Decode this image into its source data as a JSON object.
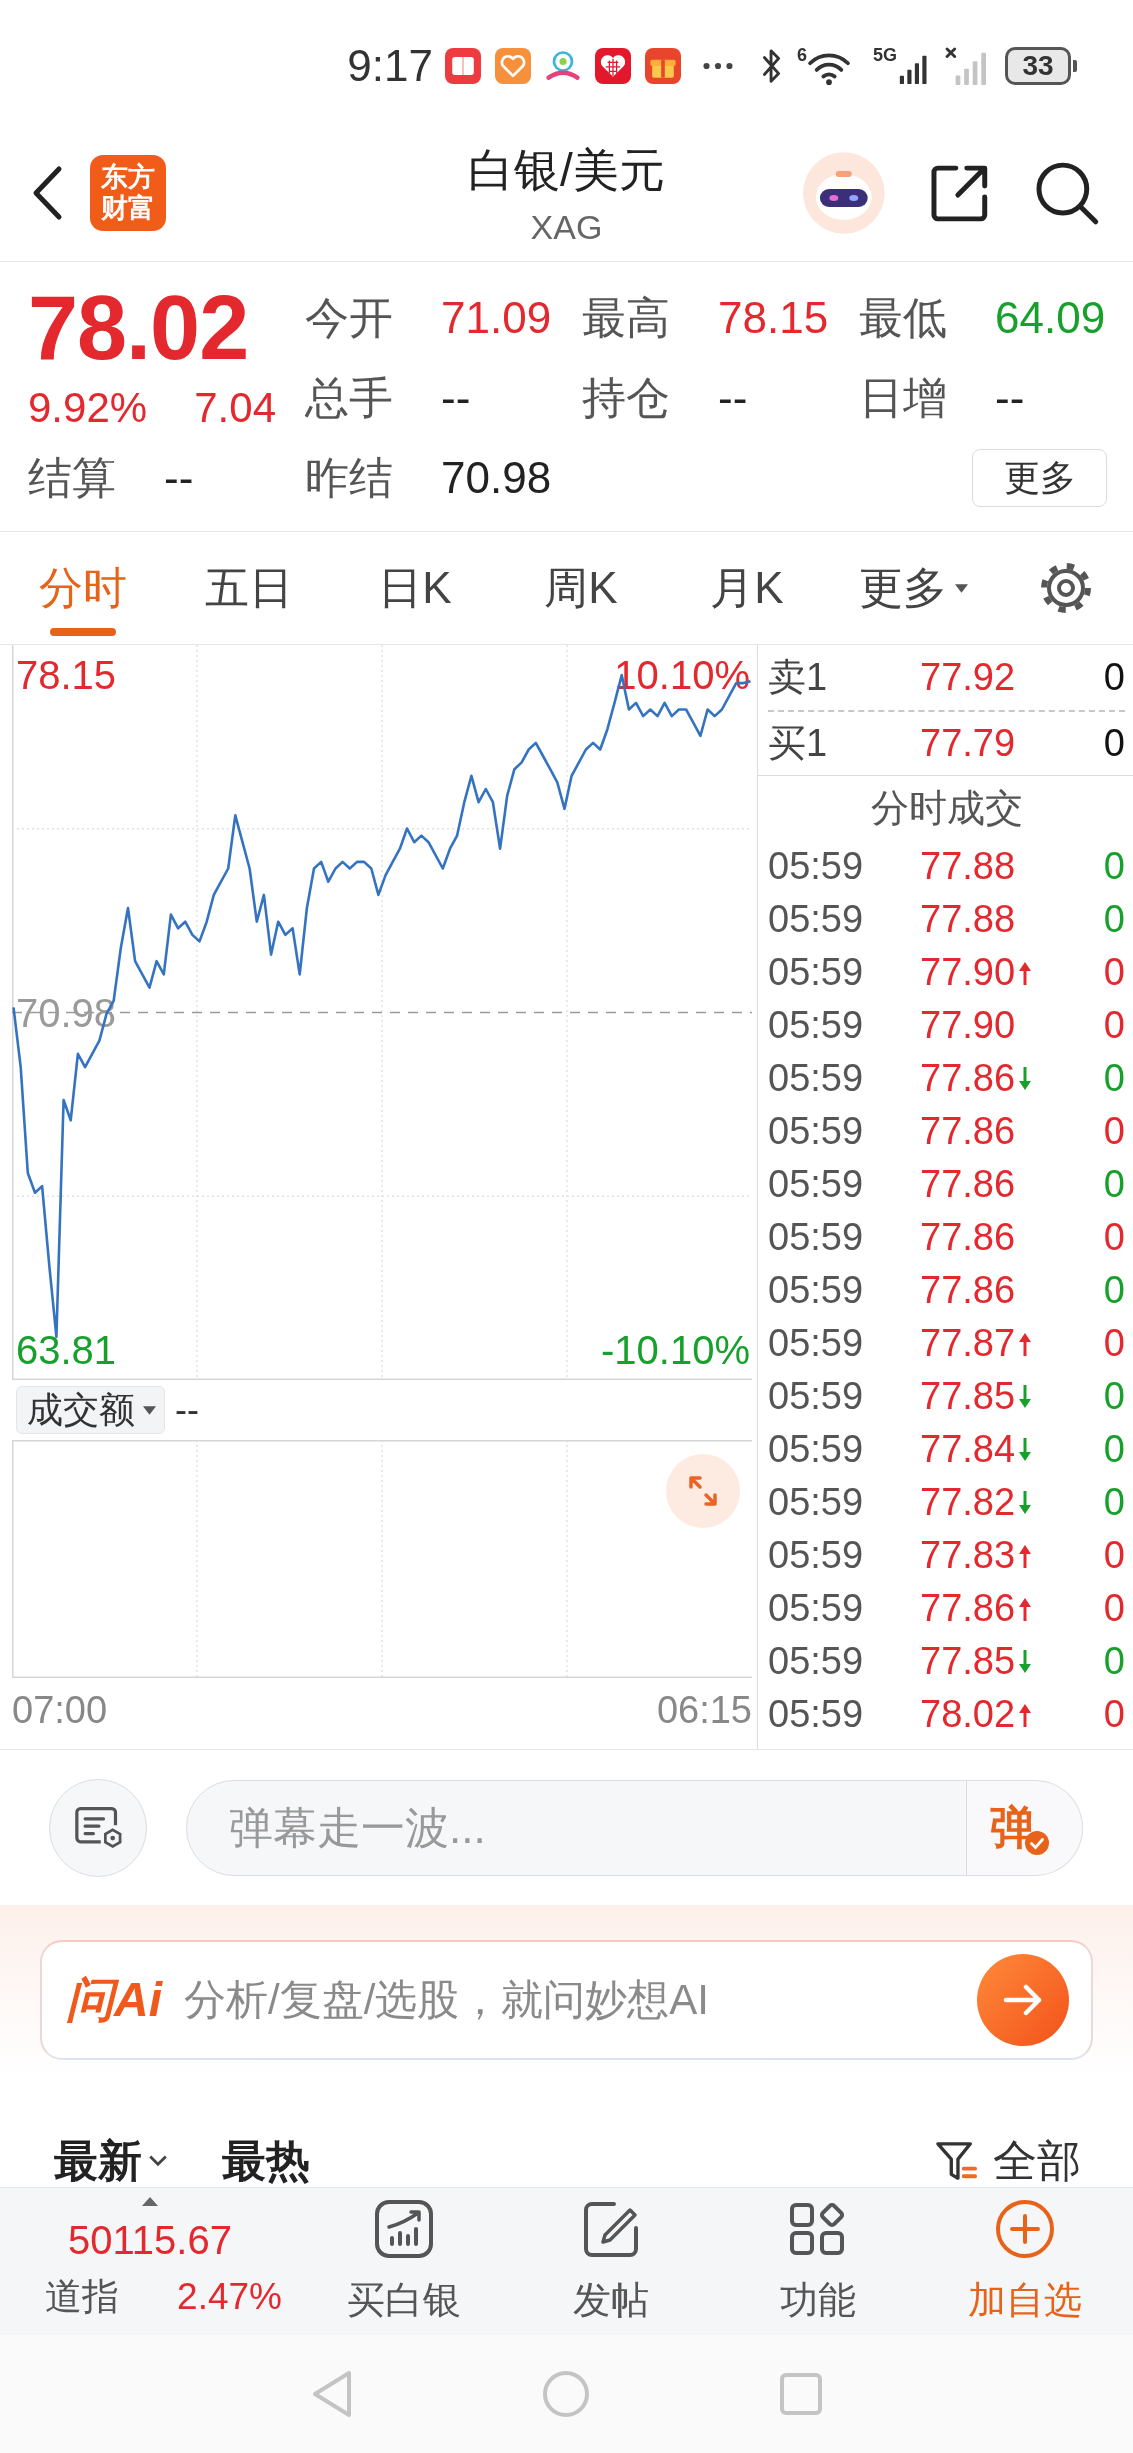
{
  "status_bar": {
    "time": "9:17",
    "notifications": [
      {
        "kind": "book"
      },
      {
        "kind": "heart"
      },
      {
        "kind": "swirl"
      },
      {
        "kind": "heart-grid"
      },
      {
        "kind": "gift"
      }
    ],
    "wifi_badge": "6",
    "network": "5G",
    "battery": "33"
  },
  "header": {
    "logo": "东方财富",
    "title": "白银/美元",
    "subtitle": "XAG"
  },
  "quote": {
    "price": "78.02",
    "change_pct": "9.92%",
    "change": "7.04",
    "stats": [
      {
        "label": "今开",
        "value": "71.09",
        "color": "#e3282e"
      },
      {
        "label": "最高",
        "value": "78.15",
        "color": "#e3282e"
      },
      {
        "label": "最低",
        "value": "64.09",
        "color": "#17a02b"
      },
      {
        "label": "总手",
        "value": "--",
        "color": "#222222"
      },
      {
        "label": "持仓",
        "value": "--",
        "color": "#222222"
      },
      {
        "label": "日增",
        "value": "--",
        "color": "#222222"
      },
      {
        "label": "结算",
        "value": "--",
        "color": "#222222"
      },
      {
        "label": "昨结",
        "value": "70.98",
        "color": "#222222"
      }
    ],
    "more_button": "更多"
  },
  "chart_tabs": [
    {
      "label": "分时",
      "selected": true,
      "kind": "tab"
    },
    {
      "label": "五日",
      "selected": false,
      "kind": "tab"
    },
    {
      "label": "日K",
      "selected": false,
      "kind": "tab"
    },
    {
      "label": "周K",
      "selected": false,
      "kind": "tab"
    },
    {
      "label": "月K",
      "selected": false,
      "kind": "tab"
    },
    {
      "label": "更多",
      "selected": false,
      "kind": "menu"
    }
  ],
  "price_chart": {
    "chart_data": {
      "type": "line",
      "series": [
        {
          "color": "#3473c2",
          "values": [
            71.09,
            69.82,
            67.57,
            67.15,
            67.29,
            65.6,
            64.09,
            69.12,
            68.69,
            70.1,
            69.82,
            70.1,
            70.38,
            70.95,
            71.23,
            72.35,
            73.2,
            72.07,
            71.79,
            71.51,
            72.07,
            71.79,
            73.06,
            72.77,
            72.91,
            72.63,
            72.49,
            72.91,
            73.48,
            73.76,
            74.04,
            75.17,
            74.6,
            74.04,
            72.91,
            73.48,
            72.21,
            72.91,
            72.63,
            72.77,
            71.79,
            73.2,
            74.04,
            74.18,
            73.76,
            74.04,
            74.18,
            74.04,
            74.18,
            74.18,
            74.04,
            73.48,
            73.9,
            74.18,
            74.46,
            74.89,
            74.6,
            74.74,
            74.6,
            74.32,
            74.04,
            74.46,
            74.74,
            75.45,
            76.01,
            75.45,
            75.73,
            75.45,
            74.46,
            75.59,
            76.15,
            76.29,
            76.57,
            76.71,
            76.43,
            76.15,
            75.87,
            75.31,
            76.01,
            76.29,
            76.57,
            76.71,
            76.57,
            77.0,
            77.56,
            78.15,
            77.42,
            77.56,
            77.28,
            77.42,
            77.28,
            77.56,
            77.28,
            77.42,
            77.42,
            77.14,
            76.86,
            77.42,
            77.28,
            77.42,
            77.7,
            77.98,
            77.98,
            78.02
          ]
        }
      ],
      "ylim": [
        63.17,
        78.79
      ],
      "yticks": [
        {
          "value": 78.15,
          "label": "78.15"
        },
        {
          "value": 63.81,
          "label": "63.81"
        }
      ],
      "ref_lines": [
        {
          "axis": "y",
          "value": 70.98,
          "label": "70.98"
        }
      ],
      "annotations": [
        "10.10%",
        "-10.10%"
      ]
    },
    "x_labels": [
      "07:00",
      "06:15"
    ]
  },
  "volume": {
    "indicator": "成交额",
    "value": "--"
  },
  "order_book": [
    {
      "label": "卖1",
      "price": "77.92",
      "volume": "0"
    },
    {
      "label": "买1",
      "price": "77.79",
      "volume": "0"
    }
  ],
  "trades": {
    "title": "分时成交",
    "rows": [
      {
        "time": "05:59",
        "price": "77.88",
        "kind": "plain",
        "volume": "0",
        "color": "#17a02b"
      },
      {
        "time": "05:59",
        "price": "77.88",
        "kind": "plain",
        "volume": "0",
        "color": "#17a02b"
      },
      {
        "time": "05:59",
        "price": "77.90",
        "kind": "up",
        "volume": "0",
        "color": "#e3282e"
      },
      {
        "time": "05:59",
        "price": "77.90",
        "kind": "plain",
        "volume": "0",
        "color": "#e3282e"
      },
      {
        "time": "05:59",
        "price": "77.86",
        "kind": "down",
        "volume": "0",
        "color": "#17a02b"
      },
      {
        "time": "05:59",
        "price": "77.86",
        "kind": "plain",
        "volume": "0",
        "color": "#e3282e"
      },
      {
        "time": "05:59",
        "price": "77.86",
        "kind": "plain",
        "volume": "0",
        "color": "#17a02b"
      },
      {
        "time": "05:59",
        "price": "77.86",
        "kind": "plain",
        "volume": "0",
        "color": "#e3282e"
      },
      {
        "time": "05:59",
        "price": "77.86",
        "kind": "plain",
        "volume": "0",
        "color": "#17a02b"
      },
      {
        "time": "05:59",
        "price": "77.87",
        "kind": "up",
        "volume": "0",
        "color": "#e3282e"
      },
      {
        "time": "05:59",
        "price": "77.85",
        "kind": "down",
        "volume": "0",
        "color": "#17a02b"
      },
      {
        "time": "05:59",
        "price": "77.84",
        "kind": "down",
        "volume": "0",
        "color": "#17a02b"
      },
      {
        "time": "05:59",
        "price": "77.82",
        "kind": "down",
        "volume": "0",
        "color": "#17a02b"
      },
      {
        "time": "05:59",
        "price": "77.83",
        "kind": "up",
        "volume": "0",
        "color": "#e3282e"
      },
      {
        "time": "05:59",
        "price": "77.86",
        "kind": "up",
        "volume": "0",
        "color": "#e3282e"
      },
      {
        "time": "05:59",
        "price": "77.85",
        "kind": "down",
        "volume": "0",
        "color": "#17a02b"
      },
      {
        "time": "05:59",
        "price": "78.02",
        "kind": "up",
        "volume": "0",
        "color": "#e3282e"
      }
    ]
  },
  "danmaku": {
    "placeholder": "弹幕走一波...",
    "send": "弹"
  },
  "ai_bar": {
    "logo": "问Ai",
    "placeholder": "分析/复盘/选股，就问妙想AI"
  },
  "feed_tabs": [
    {
      "label": "最新",
      "kind": "dropdown"
    },
    {
      "label": "最热",
      "kind": "tab"
    }
  ],
  "feed_filter": "全部",
  "bottom_nav": {
    "ticker": {
      "value": "50115.67",
      "name": "道指",
      "change": "2.47%"
    },
    "items": [
      {
        "label": "买白银",
        "kind": "trade",
        "accent": false
      },
      {
        "label": "发帖",
        "kind": "post",
        "accent": false
      },
      {
        "label": "功能",
        "kind": "functions",
        "accent": false
      },
      {
        "label": "加自选",
        "kind": "add",
        "accent": true
      }
    ]
  }
}
